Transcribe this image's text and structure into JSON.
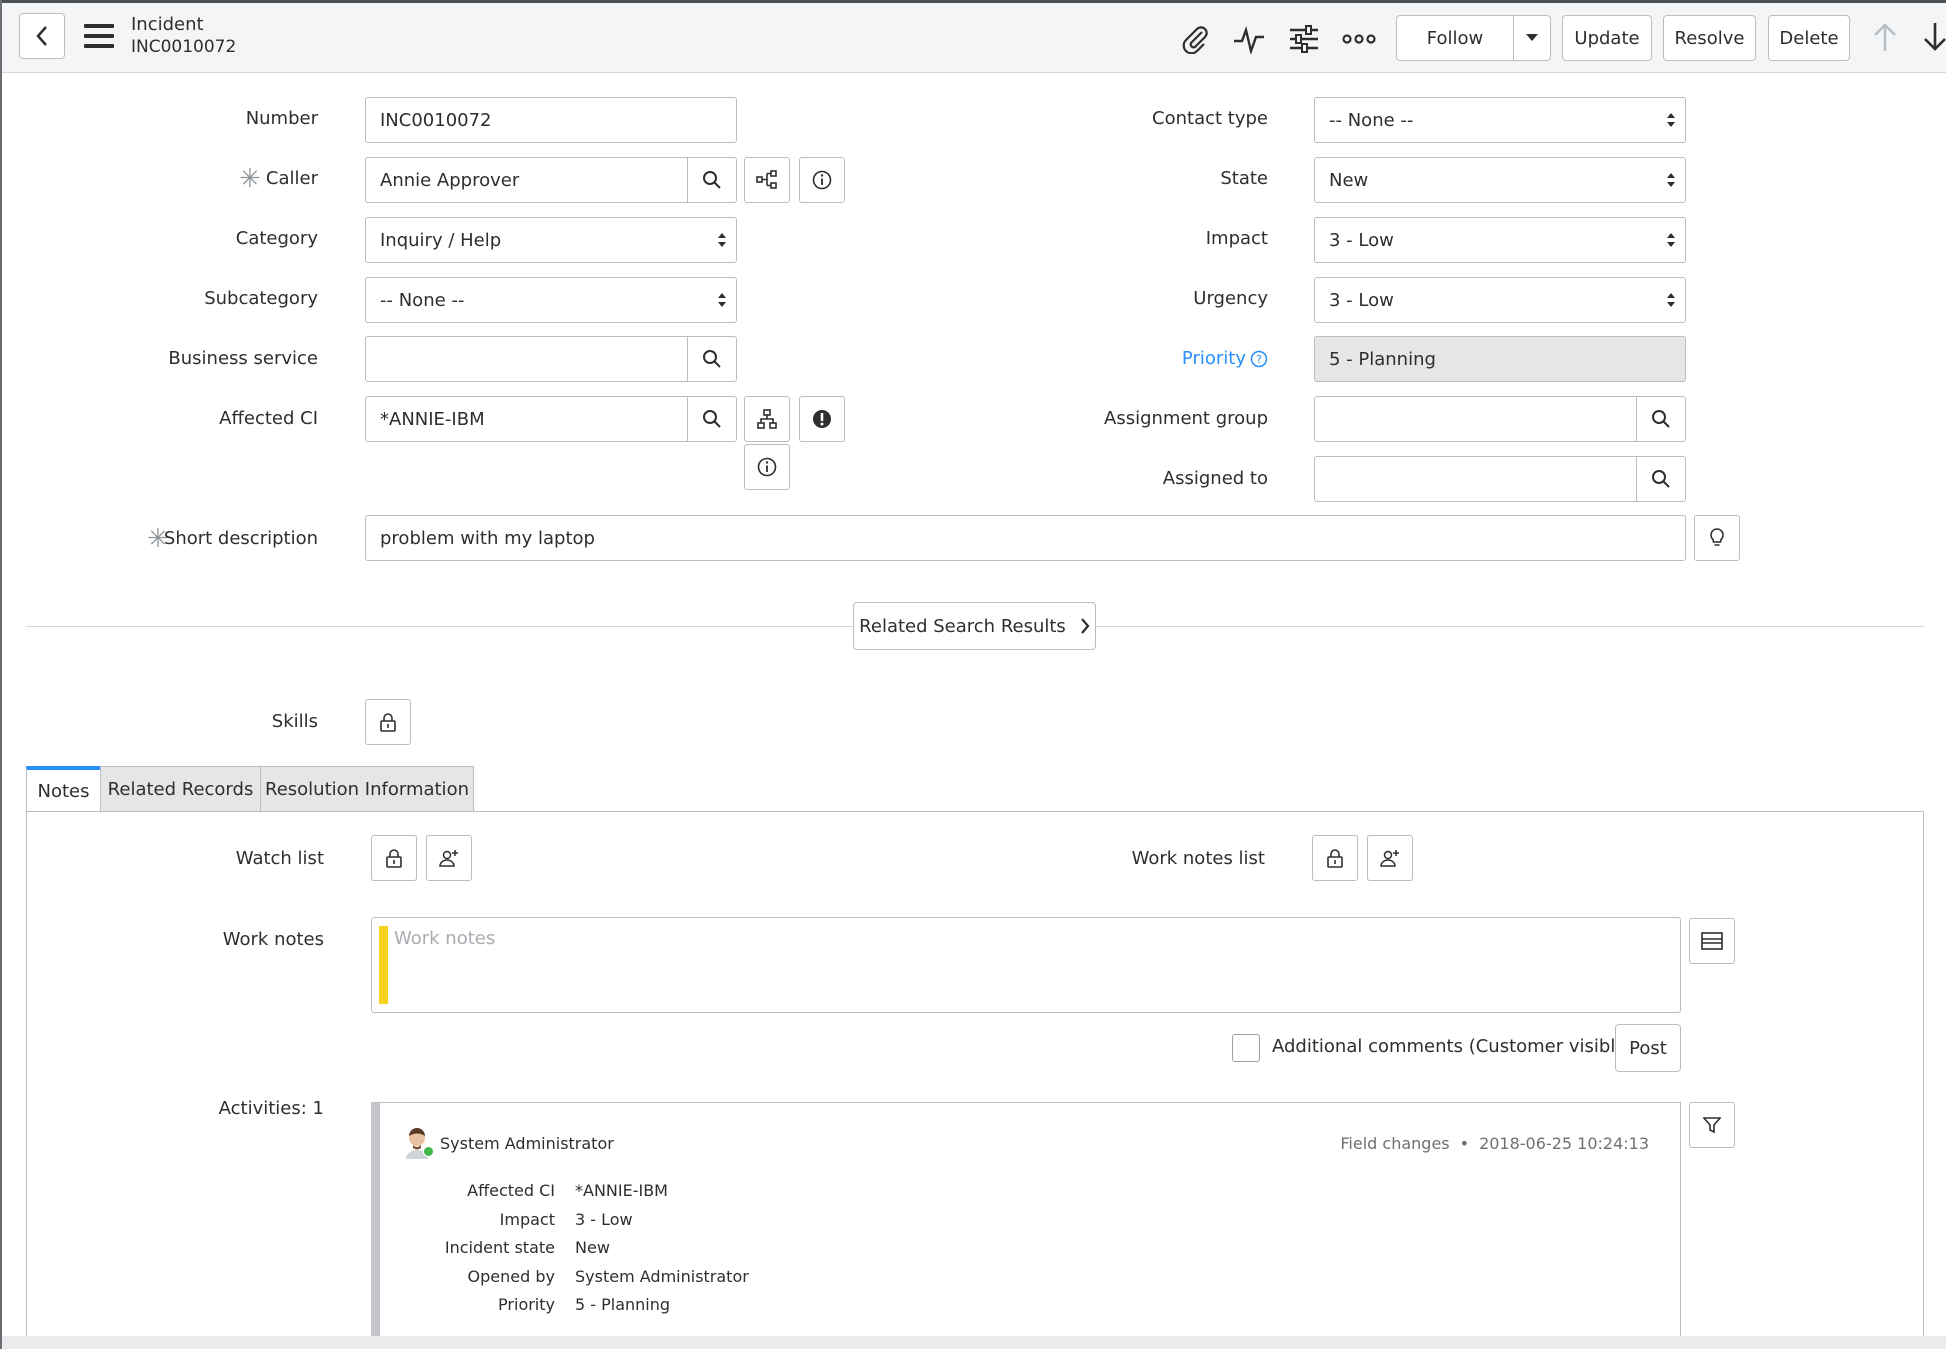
{
  "header": {
    "record_type": "Incident",
    "record_number": "INC0010072",
    "buttons": {
      "follow": "Follow",
      "update": "Update",
      "resolve": "Resolve",
      "delete": "Delete"
    },
    "icons": [
      "back-icon",
      "menu-icon",
      "paperclip-icon",
      "activity-pulse-icon",
      "settings-sliders-icon",
      "more-options-icon",
      "caret-down-icon",
      "arrow-up-icon",
      "arrow-down-icon"
    ]
  },
  "form": {
    "number": {
      "label": "Number",
      "value": "INC0010072"
    },
    "caller": {
      "label": "Caller",
      "value": "Annie Approver"
    },
    "category": {
      "label": "Category",
      "value": "Inquiry / Help"
    },
    "subcategory": {
      "label": "Subcategory",
      "value": "-- None --"
    },
    "business_service": {
      "label": "Business service",
      "value": ""
    },
    "affected_ci": {
      "label": "Affected CI",
      "value": "*ANNIE-IBM"
    },
    "contact_type": {
      "label": "Contact type",
      "value": "-- None --"
    },
    "state": {
      "label": "State",
      "value": "New"
    },
    "impact": {
      "label": "Impact",
      "value": "3 - Low"
    },
    "urgency": {
      "label": "Urgency",
      "value": "3 - Low"
    },
    "priority": {
      "label": "Priority",
      "value": "5 - Planning"
    },
    "assignment_group": {
      "label": "Assignment group",
      "value": ""
    },
    "assigned_to": {
      "label": "Assigned to",
      "value": ""
    },
    "short_description": {
      "label": "Short description",
      "value": "problem with my laptop"
    },
    "related_search_label": "Related Search Results",
    "skills_label": "Skills"
  },
  "tabs": [
    {
      "label": "Notes",
      "active": true
    },
    {
      "label": "Related Records",
      "active": false
    },
    {
      "label": "Resolution Information",
      "active": false
    }
  ],
  "notes": {
    "watch_list_label": "Watch list",
    "work_notes_list_label": "Work notes list",
    "work_notes_label": "Work notes",
    "work_notes_placeholder": "Work notes",
    "additional_comments_label": "Additional comments (Customer visible)",
    "post_label": "Post",
    "activities_label": "Activities: 1"
  },
  "activity": {
    "author": "System Administrator",
    "type": "Field changes",
    "separator": "•",
    "timestamp": "2018-06-25 10:24:13",
    "changes": [
      {
        "field": "Affected CI",
        "value": "*ANNIE-IBM"
      },
      {
        "field": "Impact",
        "value": "3 - Low"
      },
      {
        "field": "Incident state",
        "value": "New"
      },
      {
        "field": "Opened by",
        "value": "System Administrator"
      },
      {
        "field": "Priority",
        "value": "5 - Planning"
      }
    ]
  },
  "colors": {
    "accent": "#278efc",
    "work_notes_bar": "#f7d21f",
    "readonly_bg": "#e4e6e8",
    "presence": "#41b649"
  }
}
